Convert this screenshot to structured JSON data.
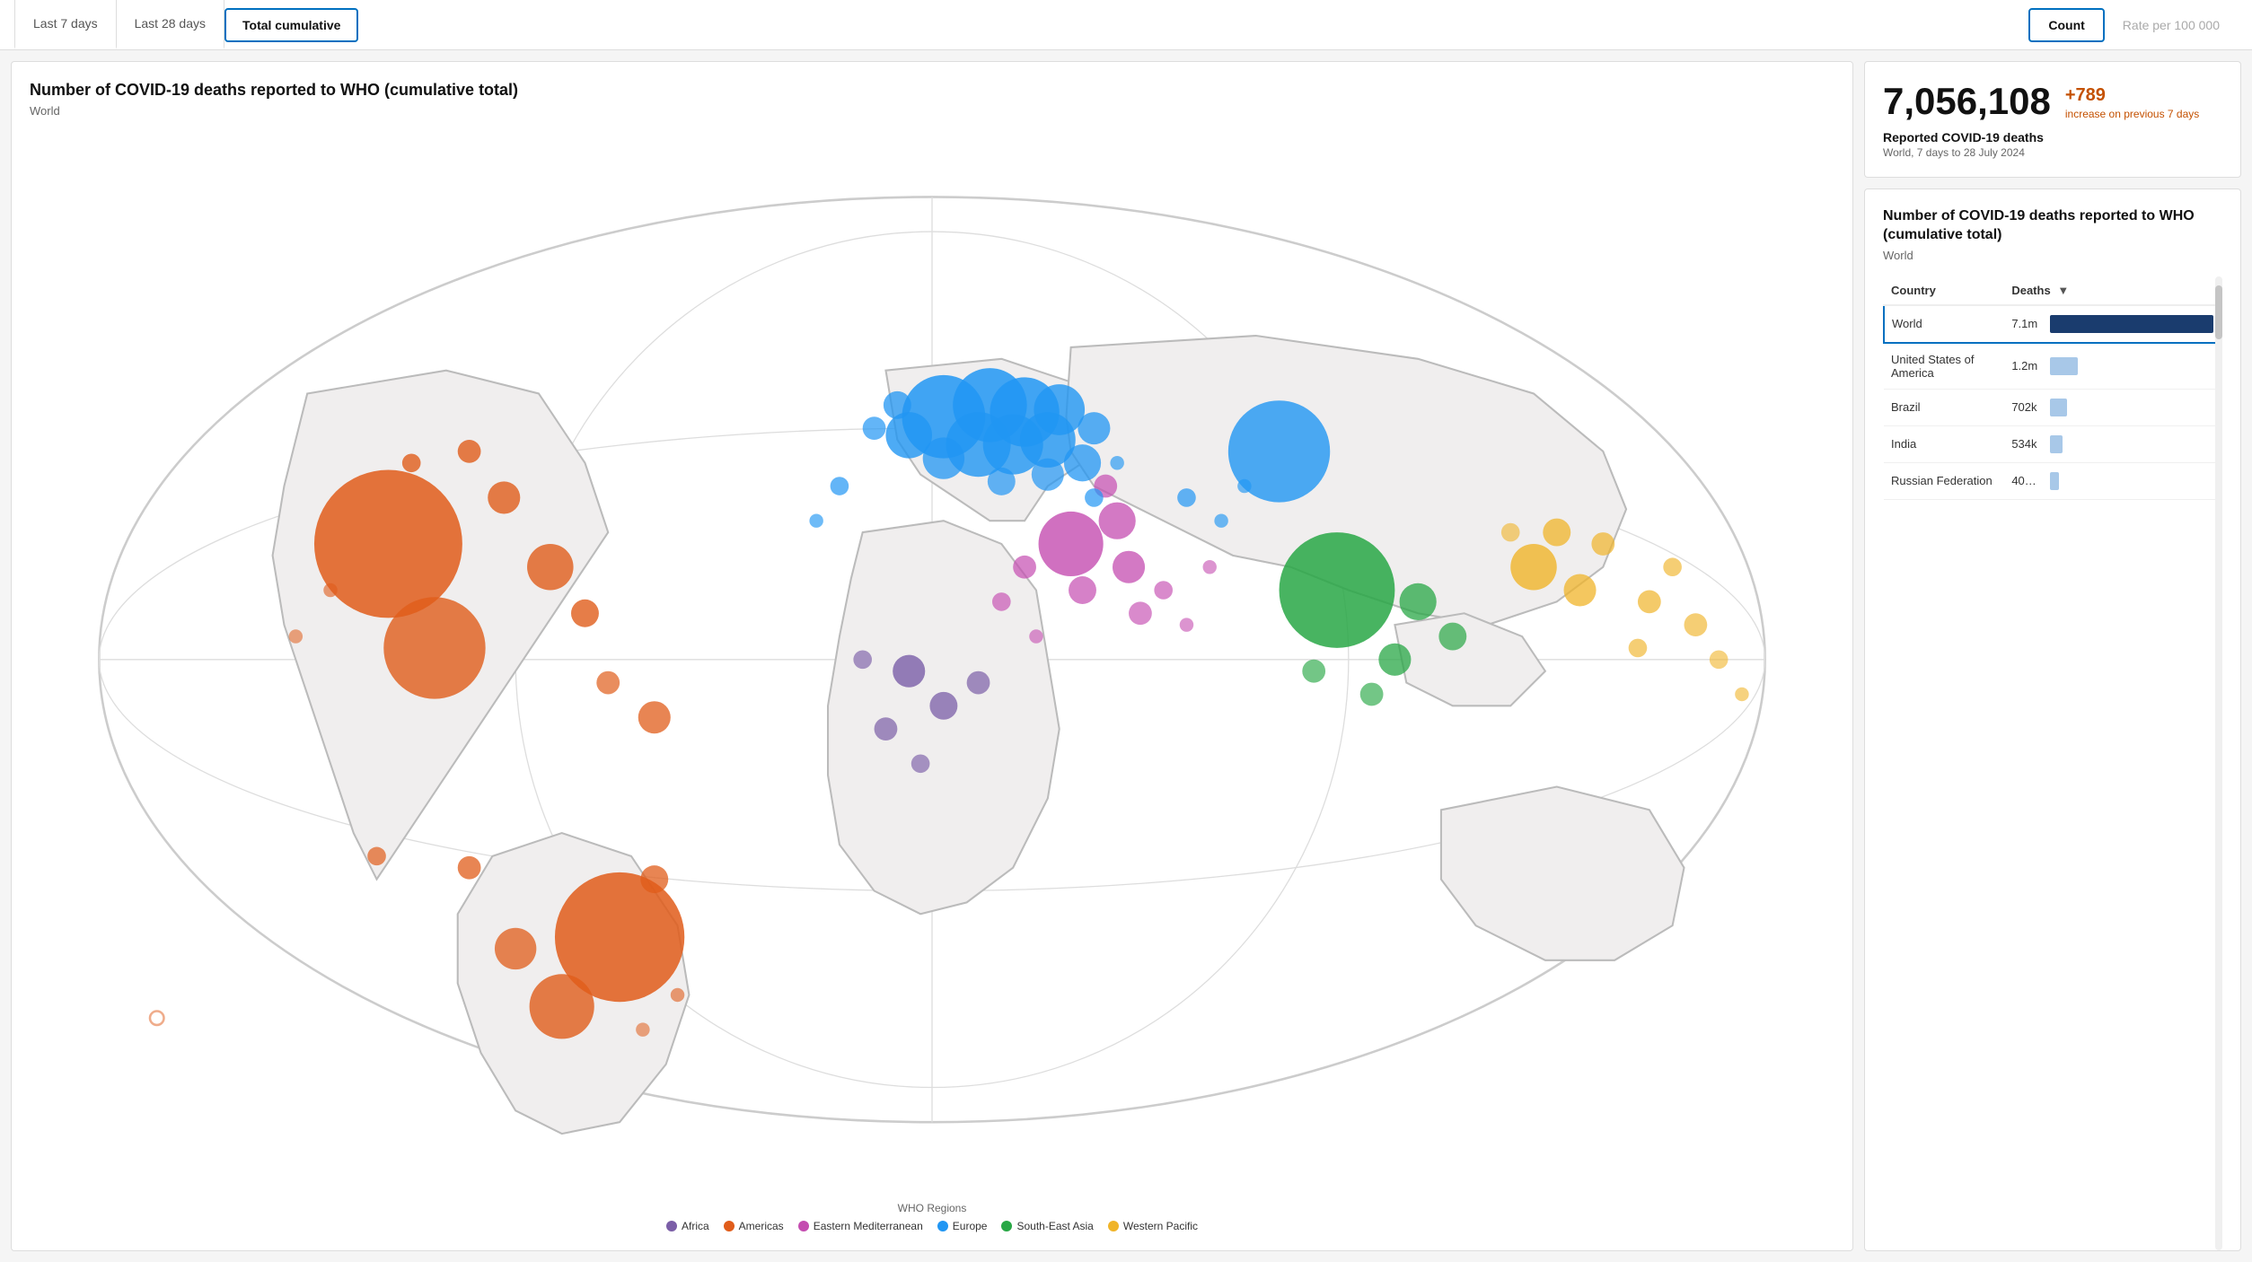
{
  "tabs": {
    "items": [
      {
        "id": "last7",
        "label": "Last 7 days",
        "active": false
      },
      {
        "id": "last28",
        "label": "Last 28 days",
        "active": false
      },
      {
        "id": "total",
        "label": "Total cumulative",
        "active": true
      }
    ]
  },
  "metrics": {
    "items": [
      {
        "id": "count",
        "label": "Count",
        "active": true
      },
      {
        "id": "rate",
        "label": "Rate per 100 000",
        "active": false
      }
    ]
  },
  "map": {
    "title": "Number of COVID-19 deaths reported to WHO (cumulative total)",
    "subtitle": "World",
    "legend_title": "WHO Regions",
    "legend_items": [
      {
        "label": "Africa",
        "color": "#7b5ea7"
      },
      {
        "label": "Americas",
        "color": "#e05c1a"
      },
      {
        "label": "Eastern Mediterranean",
        "color": "#c44cb0"
      },
      {
        "label": "Europe",
        "color": "#2196F3"
      },
      {
        "label": "South-East Asia",
        "color": "#28a745"
      },
      {
        "label": "Western Pacific",
        "color": "#f0b429"
      }
    ]
  },
  "stats": {
    "main_number": "7,056,108",
    "increase": "+789",
    "increase_label": "increase on previous 7 days",
    "reported_label": "Reported COVID-19 deaths",
    "meta": "World, 7 days to 28 July 2024"
  },
  "table": {
    "title": "Number of COVID-19 deaths reported to WHO (cumulative total)",
    "subtitle": "World",
    "col_country": "Country",
    "col_deaths": "Deaths",
    "rows": [
      {
        "country": "World",
        "deaths": "7.1m",
        "bar_pct": 100,
        "bar_type": "dark-blue",
        "highlighted": true
      },
      {
        "country": "United States of\nAmerica",
        "deaths": "1.2m",
        "bar_pct": 17,
        "bar_type": "light-blue",
        "highlighted": false
      },
      {
        "country": "Brazil",
        "deaths": "702k",
        "bar_pct": 10,
        "bar_type": "light-blue",
        "highlighted": false
      },
      {
        "country": "India",
        "deaths": "534k",
        "bar_pct": 7.5,
        "bar_type": "light-blue",
        "highlighted": false
      },
      {
        "country": "Russian Federation",
        "deaths": "40…",
        "bar_pct": 5.5,
        "bar_type": "light-blue",
        "highlighted": false
      }
    ]
  }
}
